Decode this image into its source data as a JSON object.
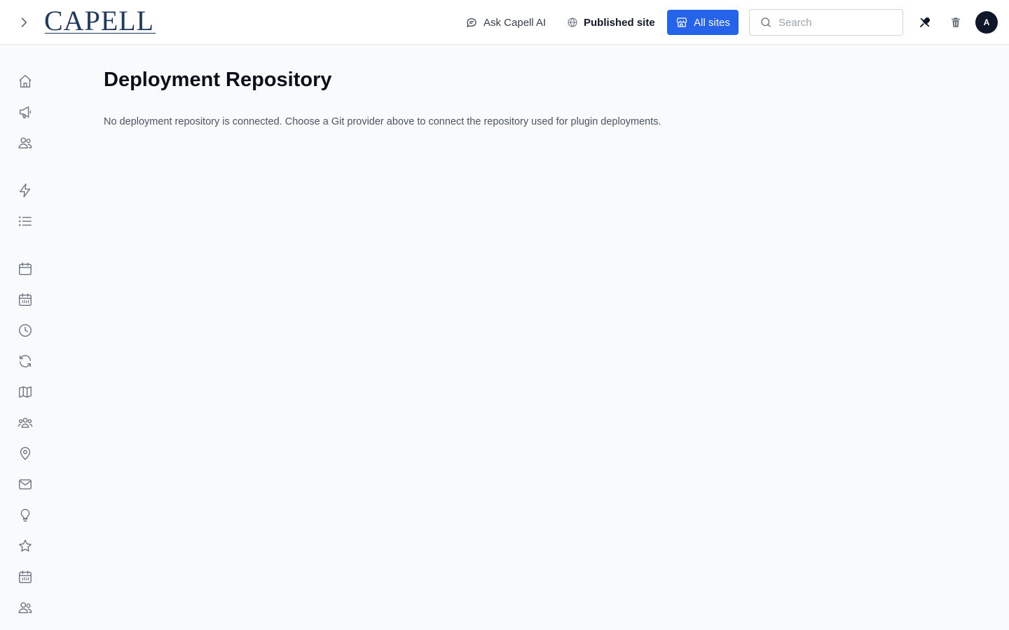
{
  "header": {
    "logo_text": "CAPELL",
    "ask_ai_label": "Ask Capell AI",
    "published_site_label": "Published site",
    "all_sites_label": "All sites",
    "search_placeholder": "Search",
    "avatar_initial": "A",
    "accent_color": "#2563eb"
  },
  "sidebar": {
    "items": [
      {
        "icon": "home-icon"
      },
      {
        "icon": "megaphone-icon"
      },
      {
        "icon": "users-icon"
      },
      {
        "icon": "lightning-icon"
      },
      {
        "icon": "list-icon"
      },
      {
        "icon": "calendar-icon"
      },
      {
        "icon": "calendar-grid-icon"
      },
      {
        "icon": "clock-icon"
      },
      {
        "icon": "refresh-icon"
      },
      {
        "icon": "map-icon"
      },
      {
        "icon": "user-group-icon"
      },
      {
        "icon": "map-pin-icon"
      },
      {
        "icon": "envelope-icon"
      },
      {
        "icon": "lightbulb-icon"
      },
      {
        "icon": "star-icon"
      },
      {
        "icon": "calendar-grid-icon"
      },
      {
        "icon": "users-icon"
      }
    ]
  },
  "main": {
    "title": "Deployment Repository",
    "description": "No deployment repository is connected. Choose a Git provider above to connect the repository used for plugin deployments."
  }
}
